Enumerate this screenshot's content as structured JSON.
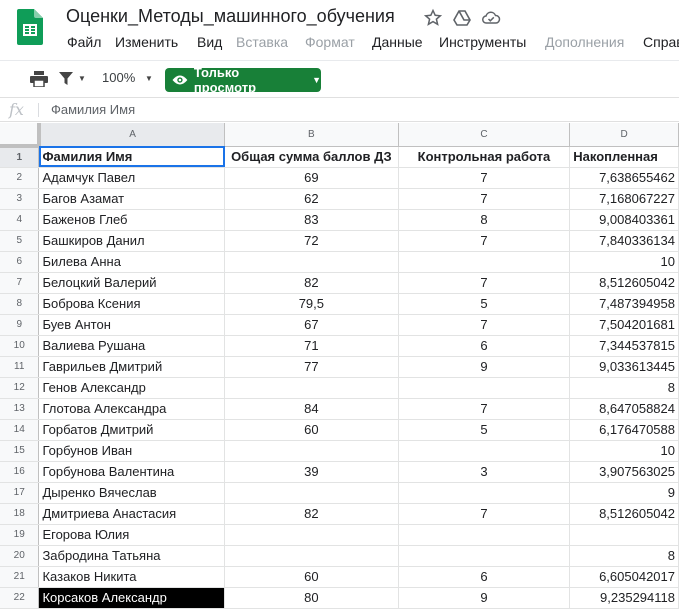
{
  "doc": {
    "title": "Оценки_Методы_машинного_обучения"
  },
  "menu": [
    "Файл",
    "Изменить",
    "Вид",
    "Вставка",
    "Формат",
    "Данные",
    "Инструменты",
    "Дополнения",
    "Справ"
  ],
  "menu_disabled": [
    "Вставка",
    "Формат",
    "Дополнения"
  ],
  "toolbar": {
    "zoom": "100%",
    "view_mode": "Только просмотр"
  },
  "formula_bar": {
    "fx": "fx",
    "value": "Фамилия Имя"
  },
  "colors": {
    "accent_green": "#188038",
    "selection_blue": "#1a73e8"
  },
  "sheet": {
    "columns": [
      "A",
      "B",
      "C",
      "D"
    ],
    "rows": [
      {
        "n": "1",
        "a": "Фамилия Имя",
        "b": "Общая сумма баллов ДЗ",
        "c": "Контрольная работа",
        "d": "Накопленная"
      },
      {
        "n": "2",
        "a": "Адамчук Павел",
        "b": "69",
        "c": "7",
        "d": "7,638655462"
      },
      {
        "n": "3",
        "a": "Багов Азамат",
        "b": "62",
        "c": "7",
        "d": "7,168067227"
      },
      {
        "n": "4",
        "a": "Баженов Глеб",
        "b": "83",
        "c": "8",
        "d": "9,008403361"
      },
      {
        "n": "5",
        "a": "Башкиров Данил",
        "b": "72",
        "c": "7",
        "d": "7,840336134"
      },
      {
        "n": "6",
        "a": "Билева Анна",
        "b": "",
        "c": "",
        "d": "10"
      },
      {
        "n": "7",
        "a": "Белоцкий Валерий",
        "b": "82",
        "c": "7",
        "d": "8,512605042"
      },
      {
        "n": "8",
        "a": "Боброва Ксения",
        "b": "79,5",
        "c": "5",
        "d": "7,487394958"
      },
      {
        "n": "9",
        "a": "Буев Антон",
        "b": "67",
        "c": "7",
        "d": "7,504201681"
      },
      {
        "n": "10",
        "a": "Валиева Рушана",
        "b": "71",
        "c": "6",
        "d": "7,344537815"
      },
      {
        "n": "11",
        "a": "Гаврильев Дмитрий",
        "b": "77",
        "c": "9",
        "d": "9,033613445"
      },
      {
        "n": "12",
        "a": "Генов Александр",
        "b": "",
        "c": "",
        "d": "8"
      },
      {
        "n": "13",
        "a": "Глотова Александра",
        "b": "84",
        "c": "7",
        "d": "8,647058824"
      },
      {
        "n": "14",
        "a": "Горбатов Дмитрий",
        "b": "60",
        "c": "5",
        "d": "6,176470588"
      },
      {
        "n": "15",
        "a": "Горбунов Иван",
        "b": "",
        "c": "",
        "d": "10"
      },
      {
        "n": "16",
        "a": "Горбунова Валентина",
        "b": "39",
        "c": "3",
        "d": "3,907563025"
      },
      {
        "n": "17",
        "a": "Дыренко Вячеслав",
        "b": "",
        "c": "",
        "d": "9"
      },
      {
        "n": "18",
        "a": "Дмитриева Анастасия",
        "b": "82",
        "c": "7",
        "d": "8,512605042"
      },
      {
        "n": "19",
        "a": "Егорова Юлия",
        "b": "",
        "c": "",
        "d": ""
      },
      {
        "n": "20",
        "a": "Забродина Татьяна",
        "b": "",
        "c": "",
        "d": "8"
      },
      {
        "n": "21",
        "a": "Казаков Никита",
        "b": "60",
        "c": "6",
        "d": "6,605042017"
      },
      {
        "n": "22",
        "a": "Корсаков Александр",
        "b": "80",
        "c": "9",
        "d": "9,235294118"
      }
    ]
  }
}
